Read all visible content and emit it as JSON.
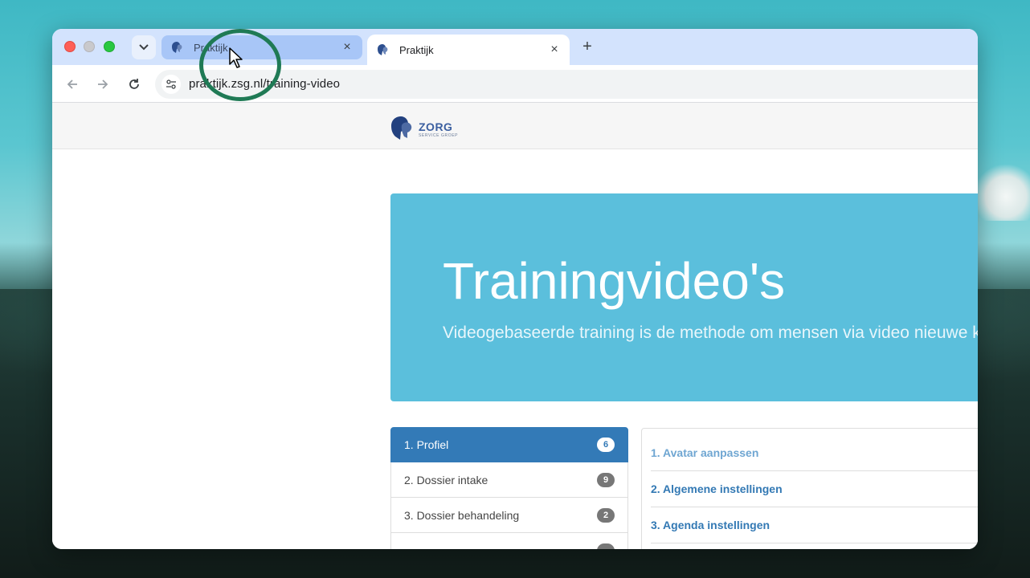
{
  "browser": {
    "tabs": [
      {
        "title": "Praktijk"
      },
      {
        "title": "Praktijk"
      }
    ],
    "new_tab_label": "+",
    "close_label": "×",
    "url": "praktijk.zsg.nl/training-video"
  },
  "site": {
    "logo_name": "ZORG",
    "logo_sub": "SERVICE GROEP"
  },
  "hero": {
    "title": "Trainingvideo's",
    "subtitle": "Videogebaseerde training is de methode om mensen via video nieuwe ke"
  },
  "categories": [
    {
      "label": "1. Profiel",
      "count": "6",
      "active": true
    },
    {
      "label": "2. Dossier intake",
      "count": "9"
    },
    {
      "label": "3. Dossier behandeling",
      "count": "2"
    },
    {
      "label": "",
      "count": ""
    }
  ],
  "videos": [
    {
      "label": "1. Avatar aanpassen"
    },
    {
      "label": "2. Algemene instellingen"
    },
    {
      "label": "3. Agenda instellingen"
    }
  ],
  "colors": {
    "hero_bg": "#5bbfdc",
    "active_item": "#337ab7",
    "link": "#3379b4",
    "highlight_ring": "#1f7a55"
  }
}
